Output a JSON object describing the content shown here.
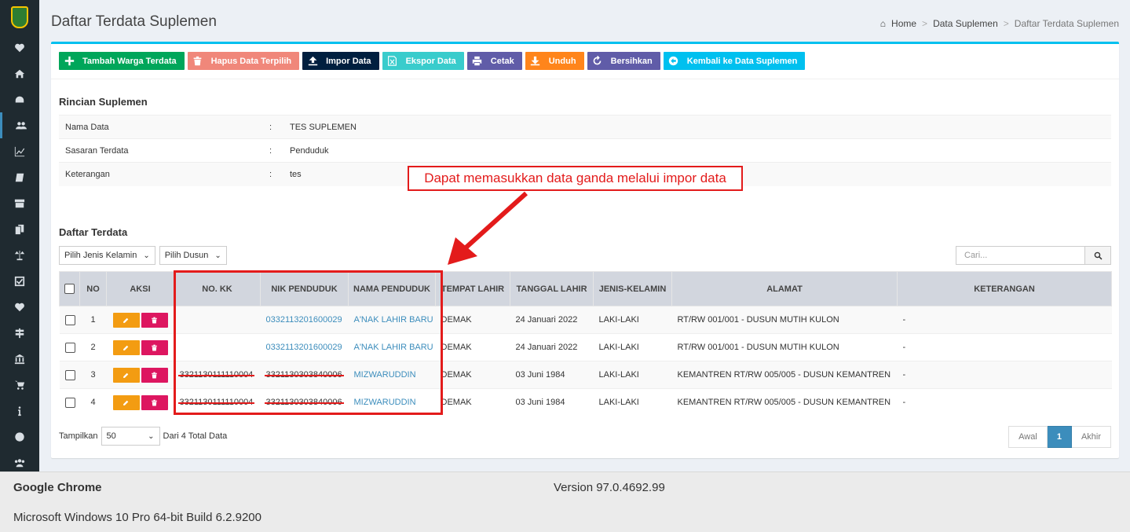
{
  "sidebar": {
    "icons": [
      "logo-icon",
      "heartbeat-icon",
      "home-icon",
      "dashboard-icon",
      "users-icon",
      "chart-icon",
      "book-icon",
      "archive-icon",
      "documents-icon",
      "balance-icon",
      "check-icon",
      "heart-icon",
      "signpost-icon",
      "bank-icon",
      "cart-icon",
      "info-icon",
      "globe-icon",
      "group-icon"
    ],
    "active_index": 4
  },
  "header": {
    "title": "Daftar Terdata Suplemen",
    "breadcrumb": [
      "Home",
      "Data Suplemen",
      "Daftar Terdata Suplemen"
    ]
  },
  "toolbar": {
    "buttons": [
      {
        "label": "Tambah Warga Terdata",
        "icon": "plus-icon",
        "color": "#00a65a"
      },
      {
        "label": "Hapus Data Terpilih",
        "icon": "trash-icon",
        "color": "#f0877a"
      },
      {
        "label": "Impor Data",
        "icon": "upload-icon",
        "color": "#001f3f"
      },
      {
        "label": "Ekspor Data",
        "icon": "excel-icon",
        "color": "#39cccc"
      },
      {
        "label": "Cetak",
        "icon": "print-icon",
        "color": "#605ca8"
      },
      {
        "label": "Unduh",
        "icon": "download-icon",
        "color": "#ff851b"
      },
      {
        "label": "Bersihkan",
        "icon": "refresh-icon",
        "color": "#605ca8"
      },
      {
        "label": "Kembali ke Data Suplemen",
        "icon": "back-arrow-icon",
        "color": "#00c0ef"
      }
    ]
  },
  "details": {
    "title": "Rincian Suplemen",
    "rows": [
      {
        "key": "Nama Data",
        "value": "TES SUPLEMEN"
      },
      {
        "key": "Sasaran Terdata",
        "value": "Penduduk"
      },
      {
        "key": "Keterangan",
        "value": "tes"
      }
    ]
  },
  "list": {
    "title": "Daftar Terdata",
    "filter_gender": "Pilih Jenis Kelamin",
    "filter_dusun": "Pilih Dusun",
    "search_placeholder": "Cari...",
    "columns": [
      "NO",
      "AKSI",
      "NO. KK",
      "NIK PENDUDUK",
      "NAMA PENDUDUK",
      "TEMPAT LAHIR",
      "TANGGAL LAHIR",
      "JENIS-KELAMIN",
      "ALAMAT",
      "KETERANGAN"
    ],
    "rows": [
      {
        "no": "1",
        "kk": "",
        "nik": "0332113201600029",
        "nama": "A'NAK LAHIR BARU",
        "tempat": "DEMAK",
        "tanggal": "24 Januari 2022",
        "jk": "LAKI-LAKI",
        "alamat": "RT/RW 001/001 - DUSUN MUTIH KULON",
        "ket": "-",
        "struck": false
      },
      {
        "no": "2",
        "kk": "",
        "nik": "0332113201600029",
        "nama": "A'NAK LAHIR BARU",
        "tempat": "DEMAK",
        "tanggal": "24 Januari 2022",
        "jk": "LAKI-LAKI",
        "alamat": "RT/RW 001/001 - DUSUN MUTIH KULON",
        "ket": "-",
        "struck": false
      },
      {
        "no": "3",
        "kk": "3321130111110004",
        "nik": "3321130303840006",
        "nama": "MIZWARUDDIN",
        "tempat": "DEMAK",
        "tanggal": "03 Juni 1984",
        "jk": "LAKI-LAKI",
        "alamat": "KEMANTREN RT/RW 005/005 - DUSUN KEMANTREN",
        "ket": "-",
        "struck": true
      },
      {
        "no": "4",
        "kk": "3321130111110004",
        "nik": "3321130303840006",
        "nama": "MIZWARUDDIN",
        "tempat": "DEMAK",
        "tanggal": "03 Juni 1984",
        "jk": "LAKI-LAKI",
        "alamat": "KEMANTREN RT/RW 005/005 - DUSUN KEMANTREN",
        "ket": "-",
        "struck": true
      }
    ],
    "show_label": "Tampilkan",
    "show_value": "50",
    "total_text": "Dari 4 Total Data",
    "pager": {
      "first": "Awal",
      "current": "1",
      "last": "Akhir"
    }
  },
  "annotation": {
    "text": "Dapat memasukkan data ganda melalui impor data",
    "color": "#e31b1b"
  },
  "sysinfo": {
    "browser": "Google Chrome",
    "version": "Version 97.0.4692.99",
    "os": "Microsoft Windows 10 Pro 64-bit Build 6.2.9200"
  }
}
